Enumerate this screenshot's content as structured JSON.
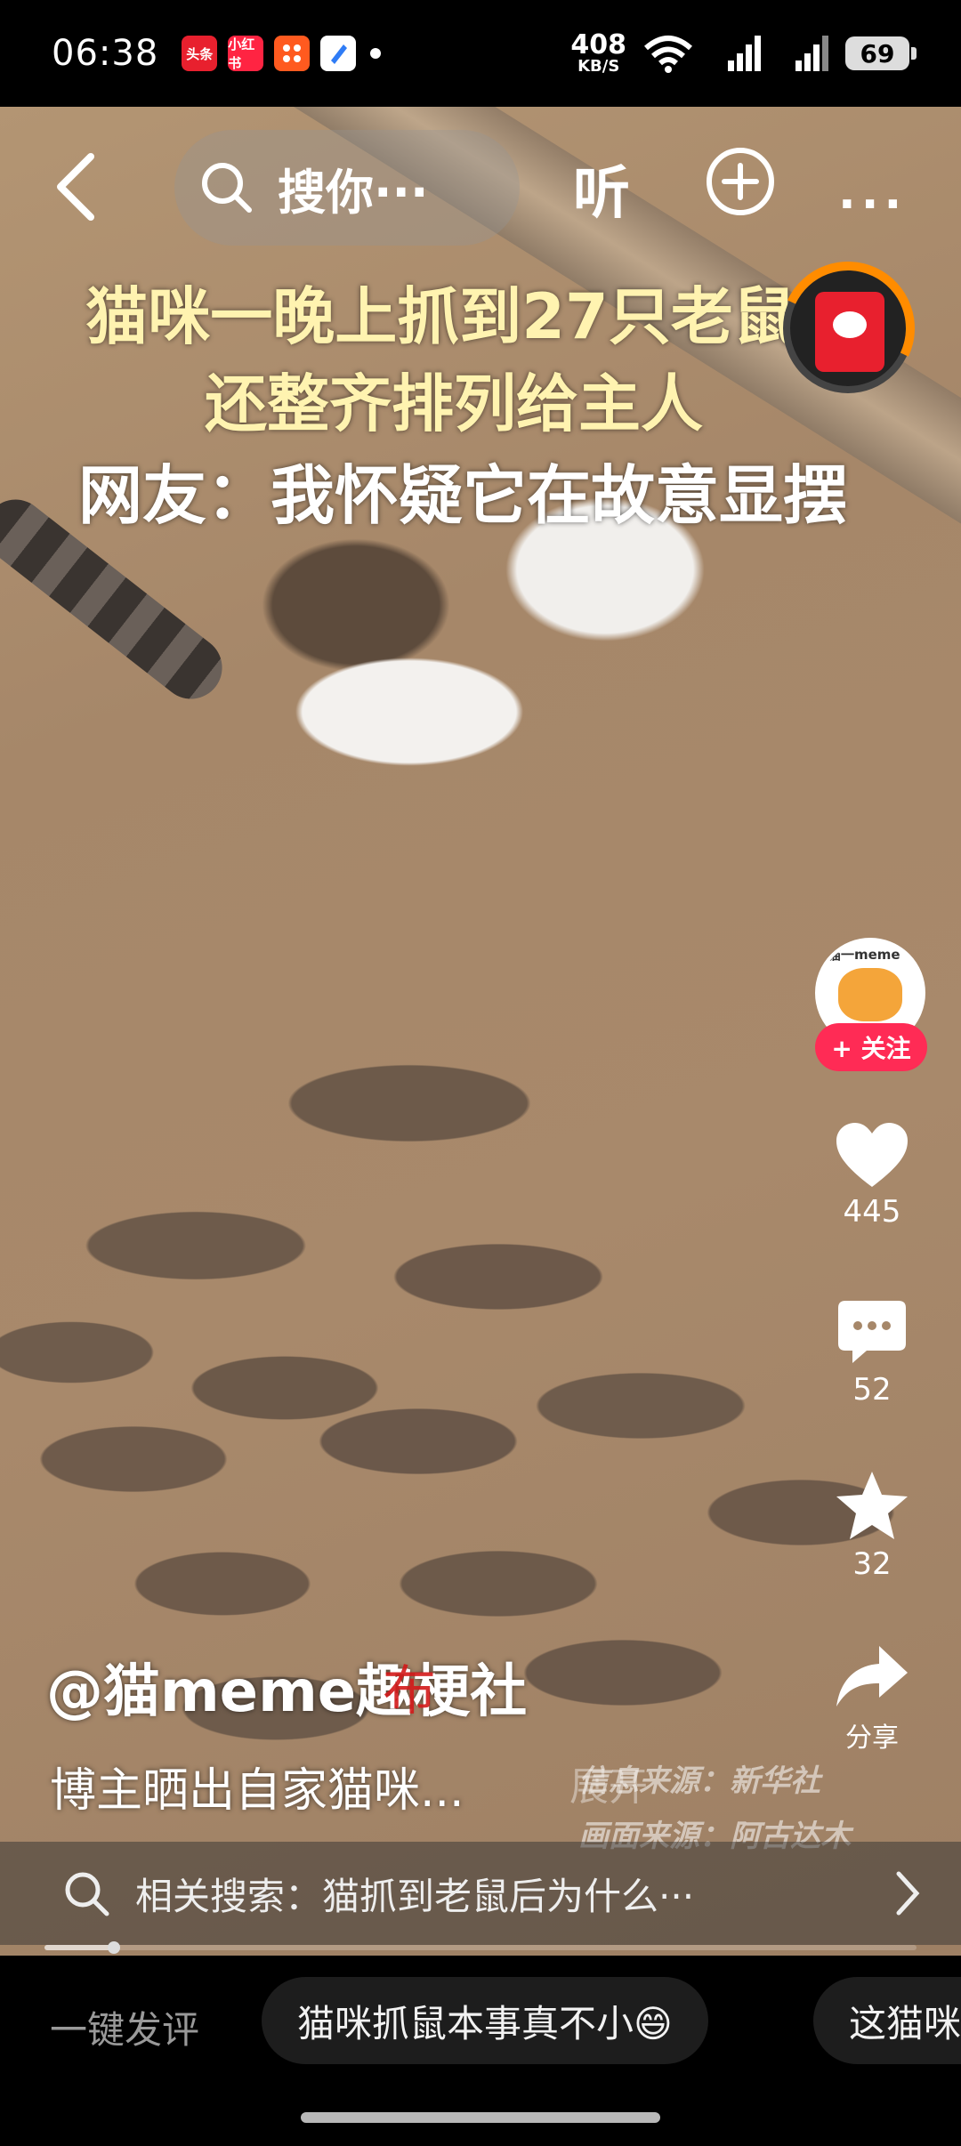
{
  "status_bar": {
    "time": "06:38",
    "notifications": [
      {
        "name": "toutiao",
        "label": "头条",
        "color": "#e8202e"
      },
      {
        "name": "xiaohongshu",
        "label": "小红书",
        "color": "#ff2442"
      },
      {
        "name": "app-orange",
        "label": "",
        "color": "#ff5a1f"
      },
      {
        "name": "app-blue",
        "label": "",
        "color": "#2f7cf6"
      }
    ],
    "net_speed_value": "408",
    "net_speed_unit": "KB/S",
    "wifi_sub": "6",
    "signal1": "5G",
    "signal2": "5G",
    "battery": "69"
  },
  "top_nav": {
    "search_placeholder": "搜你···",
    "listen_label": "听",
    "more_label": "···"
  },
  "video": {
    "caption_line1": "猫咪一晚上抓到27只老鼠",
    "caption_line2": "还整齐排列给主人",
    "caption_line3": "网友：我怀疑它在故意显摆",
    "watermark_text": "布",
    "source_news": "信息来源：新华社",
    "source_footage": "画面来源：阿古达木"
  },
  "side_rail": {
    "avatar_tag": "猫一meme",
    "follow_label": "+ 关注",
    "likes": "445",
    "comments": "52",
    "favorites": "32",
    "share_label": "分享"
  },
  "post": {
    "author": "@猫meme趣梗社",
    "description": "博主晒出自家猫咪...",
    "expand_label": "展开"
  },
  "related_search": {
    "text": "相关搜索：猫抓到老鼠后为什么···"
  },
  "playback": {
    "progress_fraction": 0.08
  },
  "bottom_bar": {
    "one_key_comment": "一键发评",
    "chips": [
      "猫咪抓鼠本事真不小😄",
      "这猫咪"
    ]
  }
}
